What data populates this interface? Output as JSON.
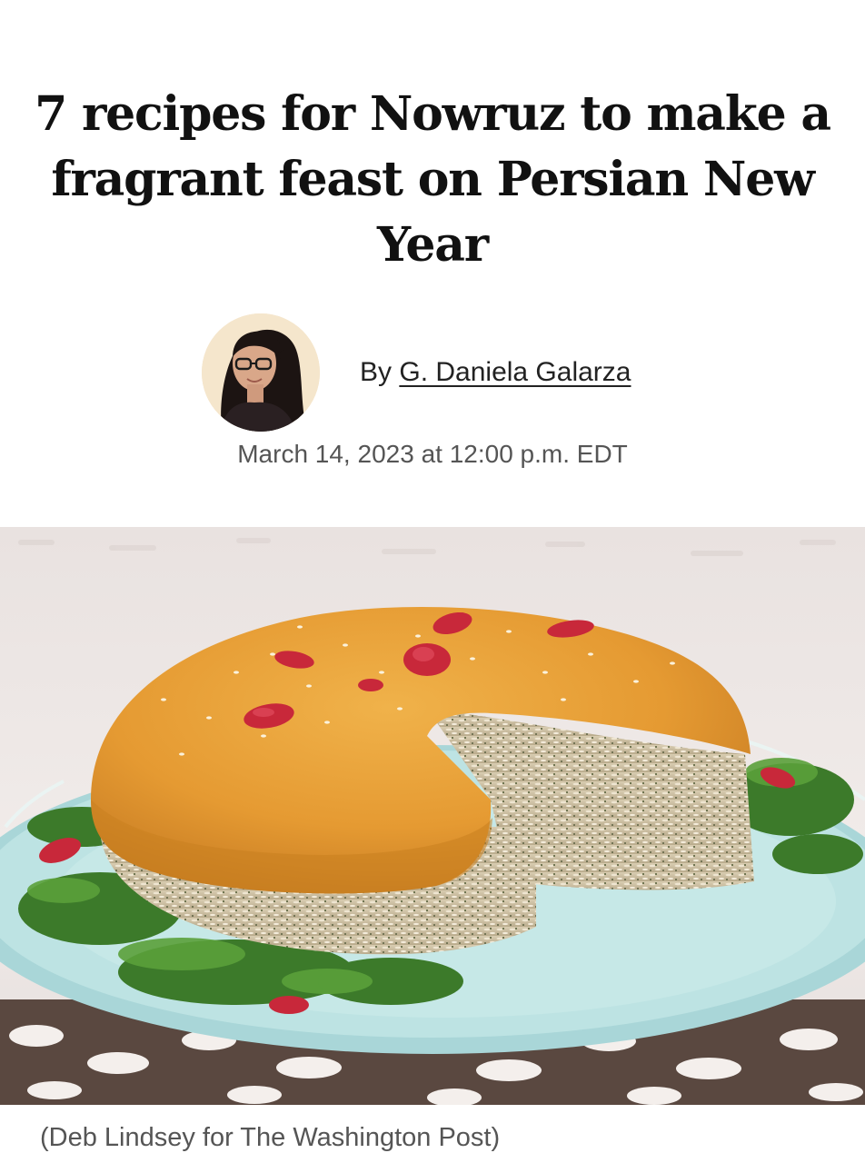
{
  "article": {
    "headline": "7 recipes for Nowruz to make a fragrant feast on Persian New Year",
    "byline_prefix": "By",
    "author_name": "G. Daniela Galarza",
    "timestamp": "March 14, 2023 at 12:00 p.m. EDT",
    "photo_caption": "(Deb Lindsey for The Washington Post)"
  },
  "icons": {
    "author_avatar": "author-portrait",
    "hero_image": "persian-rice-cake-on-blue-plate"
  },
  "colors": {
    "text": "#111111",
    "meta_text": "#555555",
    "background": "#ffffff"
  }
}
